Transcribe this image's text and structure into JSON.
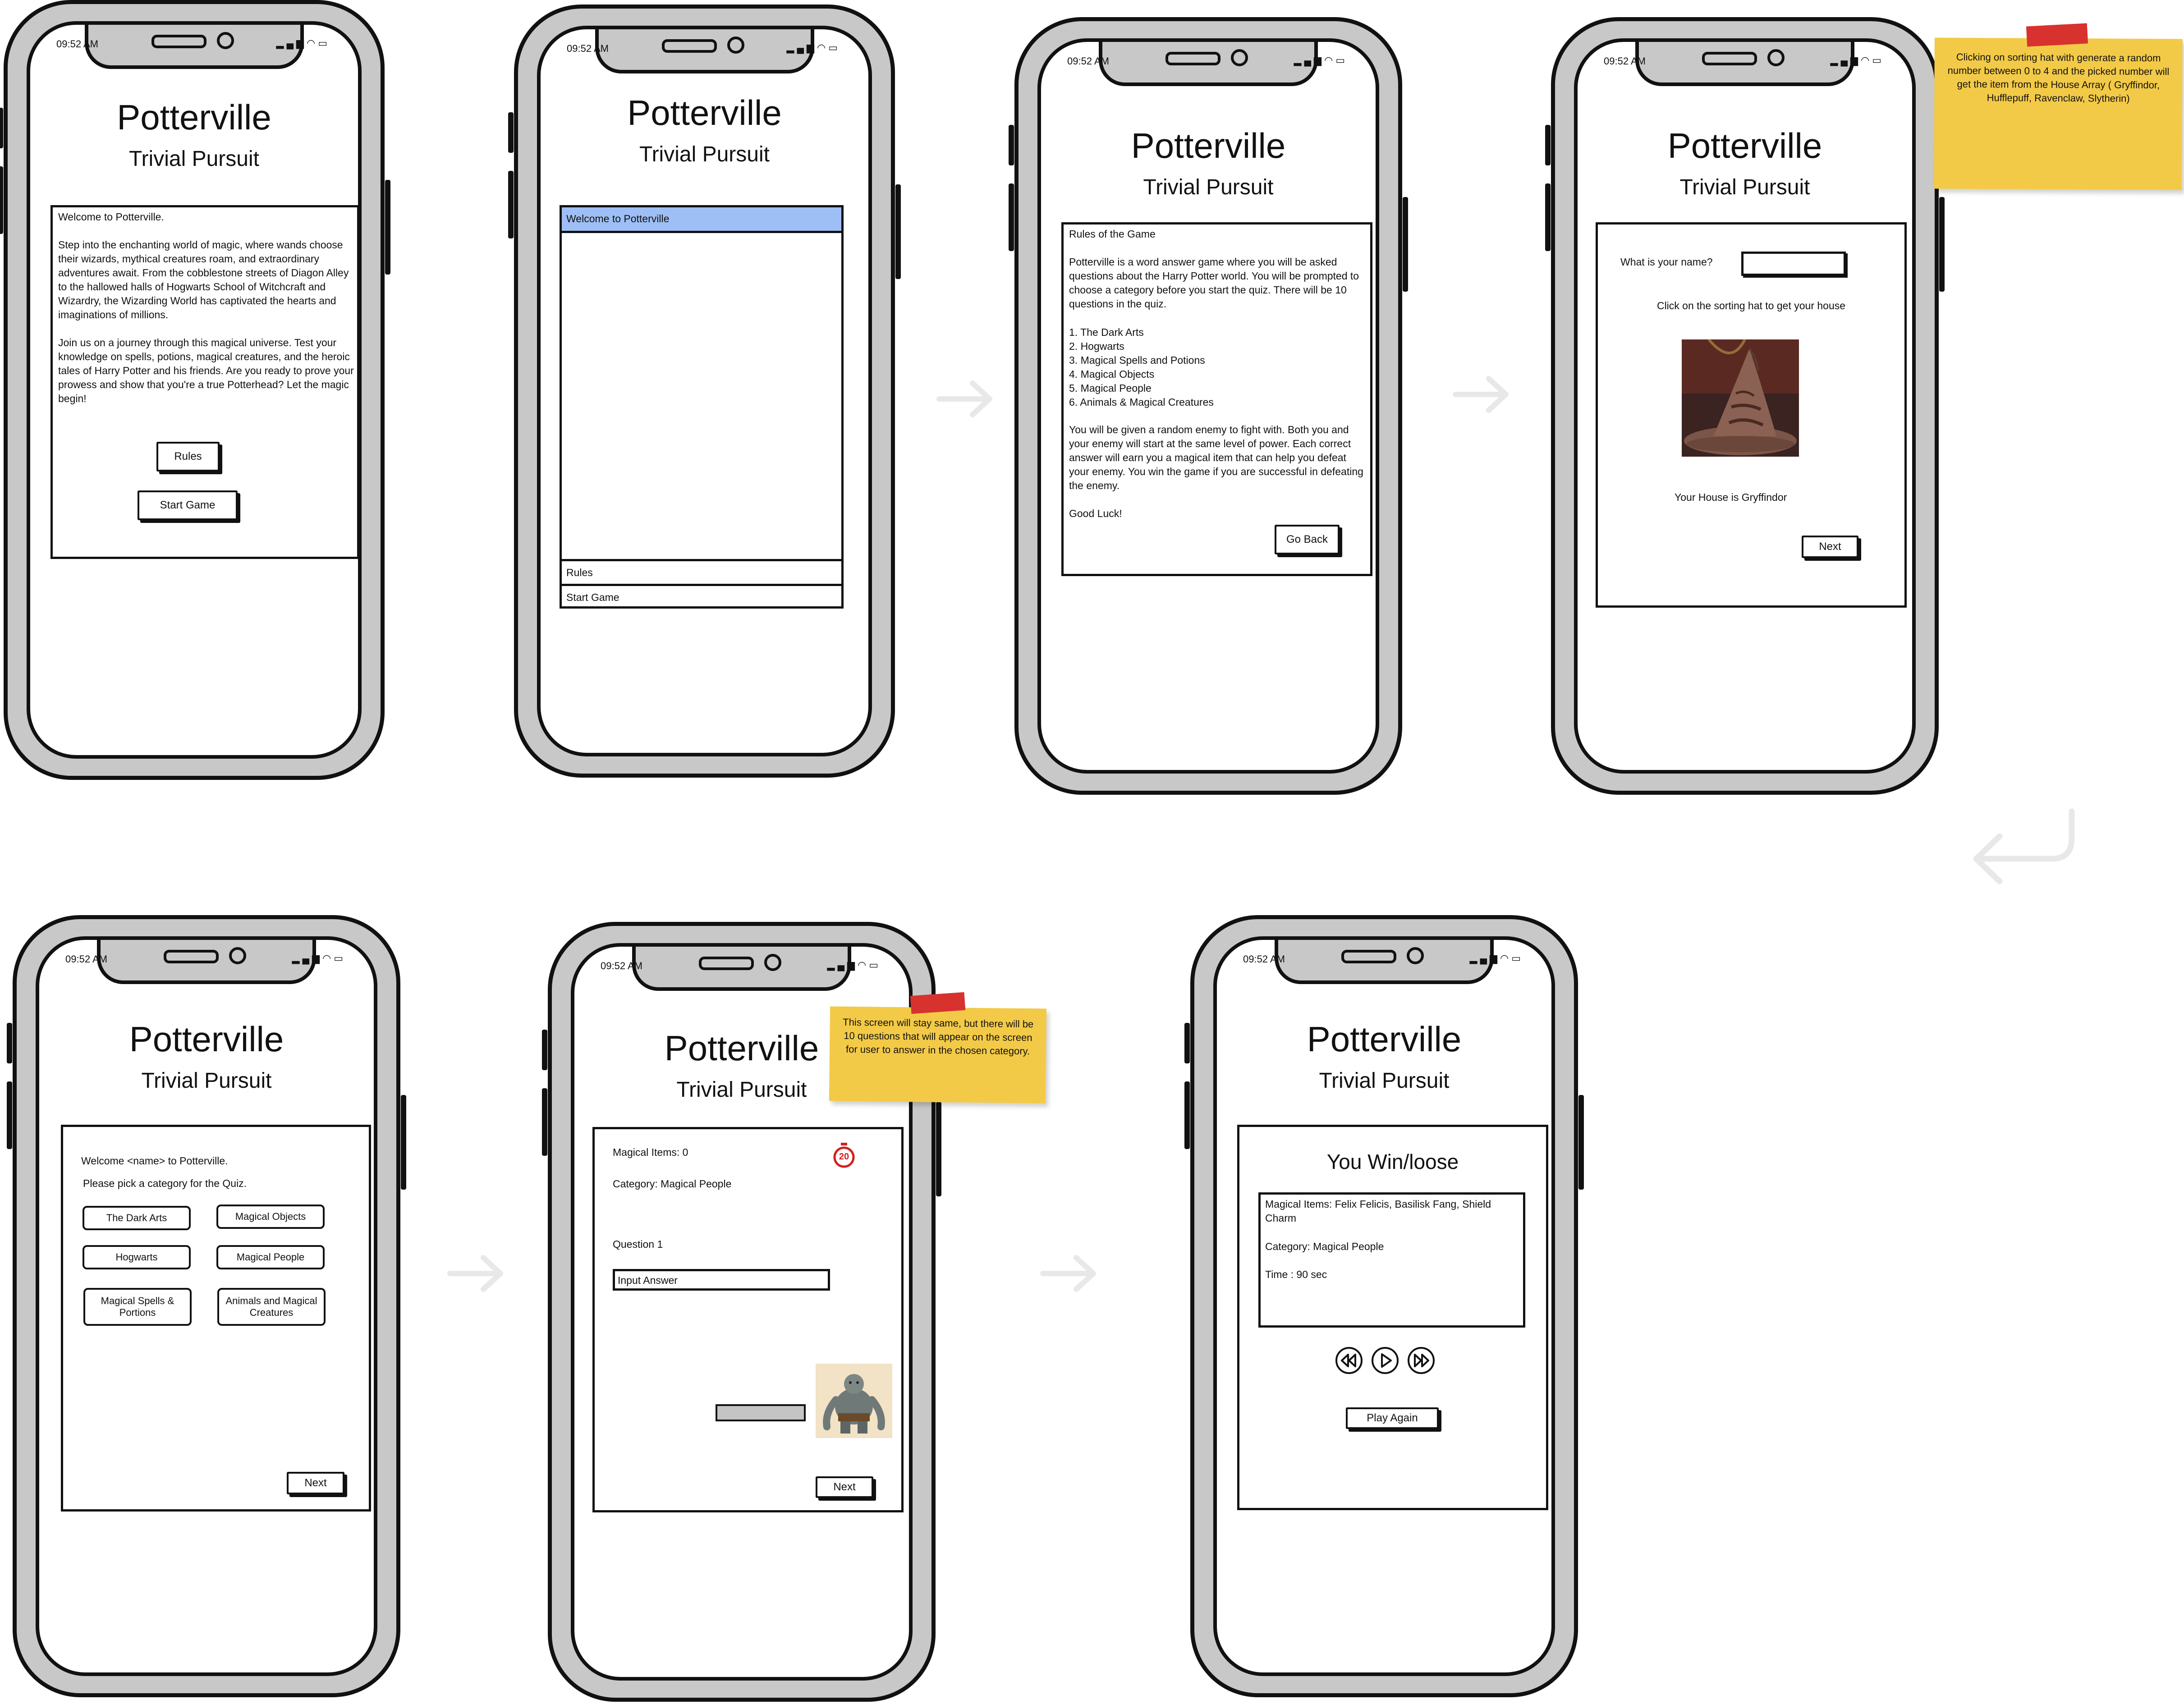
{
  "app": {
    "title": "Potterville",
    "subtitle": "Trivial Pursuit"
  },
  "status": {
    "time": "09:52 AM"
  },
  "screen1": {
    "heading": "Welcome to Potterville.",
    "para1": "Step into the enchanting world of magic, where wands choose their wizards, mythical creatures roam, and extraordinary adventures await. From the cobblestone streets of Diagon Alley to the hallowed halls of Hogwarts School of Witchcraft and Wizardry, the Wizarding World has captivated the hearts and imaginations of millions.",
    "para2": "Join us on a journey through this magical universe. Test your knowledge on spells, potions, magical creatures, and the heroic tales of Harry Potter and his friends. Are you ready to prove your prowess and show that you're a true Potterhead? Let the magic begin!",
    "rules_button": "Rules",
    "start_button": "Start Game"
  },
  "screen2": {
    "header": "Welcome to Potterville",
    "rules_item": "Rules",
    "start_item": "Start Game"
  },
  "screen3": {
    "heading": "Rules of the Game",
    "intro": "Potterville is a word answer game where you will be asked questions about the Harry Potter world.  You will be prompted to choose a category before you start the quiz. There will be 10 questions in the quiz.",
    "categories": [
      "1. The Dark Arts",
      "2. Hogwarts",
      "3. Magical Spells and Potions",
      "4. Magical Objects",
      "5. Magical People",
      "6. Animals & Magical Creatures"
    ],
    "body": "You will be given a random enemy to fight with. Both you and your enemy will start at the same level of power. Each correct answer will earn you a magical item that can help you defeat your enemy. You win the game if you are successful in defeating the enemy.",
    "closing": "Good Luck!",
    "back_button": "Go Back"
  },
  "screen4": {
    "name_label": "What is your name?",
    "instruction": "Click on the sorting hat to get your house",
    "house_text": "Your House is Gryffindor",
    "next_button": "Next"
  },
  "note1": "Clicking on sorting hat with generate a random number between 0 to 4 and the picked number will get the item from the House Array ( Gryffindor, Hufflepuff, Ravenclaw, Slytherin)",
  "screen5": {
    "welcome": "Welcome <name> to Potterville.",
    "prompt": "Please pick a category for the Quiz.",
    "cat_dark_arts": "The Dark Arts",
    "cat_objects": "Magical Objects",
    "cat_hogwarts": "Hogwarts",
    "cat_people": "Magical People",
    "cat_spells": "Magical Spells & Portions",
    "cat_animals": "Animals and Magical Creatures",
    "next_button": "Next"
  },
  "screen6": {
    "items": "Magical Items: 0",
    "category": "Category: Magical People",
    "timer": "20",
    "question": "Question 1",
    "answer_placeholder": "Input Answer",
    "next_button": "Next"
  },
  "note2": "This screen will stay same, but there will be 10 questions that will appear on the screen for user to answer in the chosen category.",
  "screen7": {
    "result": "You Win/loose",
    "items": "Magical Items: Felix Felicis, Basilisk Fang, Shield Charm",
    "category": "Category: Magical People",
    "time": "Time : 90 sec",
    "play_again": "Play Again"
  },
  "colors": {
    "phone_frame": "#c8c8c8",
    "highlight": "#9ebff5",
    "sticky": "#f3ca47",
    "tape": "#d8322f",
    "timer_red": "#d0201e",
    "arrow": "#e8e8e8"
  }
}
